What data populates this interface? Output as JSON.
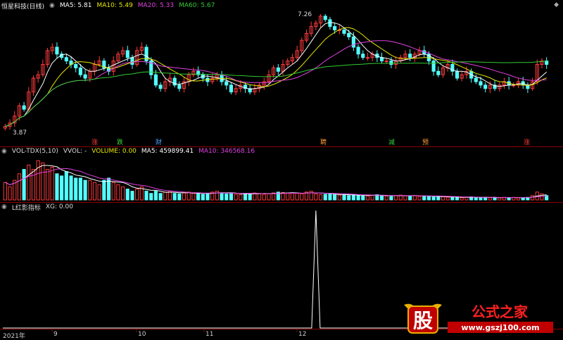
{
  "price_panel": {
    "title": "恒星科技(日线)",
    "ma5": "MA5: 5.81",
    "ma10": "MA10: 5.49",
    "ma20": "MA20: 5.33",
    "ma60": "MA60: 5.67",
    "high_label": "7.26",
    "low_label": "3.87"
  },
  "markers": [
    {
      "text": "涨",
      "color": "#ff3b3b"
    },
    {
      "text": "跌",
      "color": "#3ad13a"
    },
    {
      "text": "财",
      "color": "#4aa0ff"
    },
    {
      "text": "聘",
      "color": "#ff9a3a"
    },
    {
      "text": "减",
      "color": "#3ad13a"
    },
    {
      "text": "预",
      "color": "#ff9a3a"
    },
    {
      "text": "涨",
      "color": "#ff3b3b"
    }
  ],
  "vol_panel": {
    "name": "VOL-TDX(5,10)",
    "vvol": "VVOL: -",
    "volume": "VOLUME: 0.00",
    "ma5": "MA5: 459899.41",
    "ma10": "MA10: 346568.16"
  },
  "ind_panel": {
    "name": "L红影指标",
    "xg": "XG: 0.00"
  },
  "calendar": [
    "2021年",
    "9",
    "10",
    "11",
    "12"
  ],
  "watermark": {
    "logo": "股",
    "text": "公式之家",
    "url": "www.gszj100.com"
  },
  "colors": {
    "up": "#ff3b3b",
    "down": "#54ffff",
    "ma5": "#ffffff",
    "ma10": "#e6e600",
    "ma20": "#e040e0",
    "ma60": "#33cc33",
    "grid": "#7a0000",
    "xg": "#ffffff"
  },
  "chart_data": {
    "type": "candlestick",
    "price_closes": [
      4.0,
      4.1,
      4.3,
      4.6,
      4.5,
      5.0,
      5.4,
      5.5,
      5.8,
      6.2,
      6.3,
      6.1,
      6.0,
      5.9,
      5.8,
      5.7,
      5.5,
      5.4,
      5.6,
      5.8,
      5.9,
      5.7,
      5.6,
      5.9,
      6.1,
      6.2,
      6.0,
      5.8,
      6.2,
      6.3,
      5.9,
      5.5,
      5.2,
      5.1,
      5.3,
      5.4,
      5.2,
      5.1,
      5.3,
      5.5,
      5.6,
      5.5,
      5.4,
      5.3,
      5.4,
      5.5,
      5.3,
      5.2,
      5.0,
      5.1,
      5.2,
      5.1,
      5.0,
      5.1,
      5.2,
      5.3,
      5.5,
      5.7,
      5.6,
      5.8,
      5.9,
      6.0,
      6.2,
      6.5,
      6.7,
      6.9,
      7.0,
      7.2,
      7.1,
      6.9,
      6.8,
      6.8,
      6.7,
      6.6,
      6.3,
      6.1,
      6.0,
      6.0,
      6.1,
      6.0,
      5.9,
      5.9,
      5.8,
      5.9,
      6.0,
      6.1,
      6.0,
      6.1,
      6.2,
      6.1,
      5.9,
      5.6,
      5.5,
      5.7,
      5.8,
      5.6,
      5.4,
      5.5,
      5.6,
      5.4,
      5.3,
      5.2,
      5.1,
      5.2,
      5.1,
      5.2,
      5.3,
      5.2,
      5.2,
      5.3,
      5.2,
      5.1,
      5.3,
      5.8,
      5.9,
      5.8
    ],
    "volume_bars": [
      0.4,
      0.3,
      0.45,
      0.6,
      0.7,
      0.8,
      0.7,
      0.9,
      0.85,
      0.7,
      0.75,
      0.6,
      0.55,
      0.65,
      0.55,
      0.5,
      0.5,
      0.45,
      0.45,
      0.4,
      0.35,
      0.45,
      0.5,
      0.4,
      0.35,
      0.3,
      0.25,
      0.2,
      0.25,
      0.3,
      0.2,
      0.15,
      0.2,
      0.15,
      0.18,
      0.2,
      0.15,
      0.14,
      0.16,
      0.18,
      0.15,
      0.14,
      0.13,
      0.15,
      0.18,
      0.2,
      0.16,
      0.14,
      0.15,
      0.13,
      0.12,
      0.15,
      0.14,
      0.16,
      0.15,
      0.13,
      0.14,
      0.16,
      0.18,
      0.17,
      0.15,
      0.16,
      0.15,
      0.14,
      0.18,
      0.2,
      0.14,
      0.12,
      0.13,
      0.15,
      0.12,
      0.11,
      0.12,
      0.1,
      0.12,
      0.11,
      0.1,
      0.09,
      0.11,
      0.12,
      0.1,
      0.09,
      0.08,
      0.1,
      0.11,
      0.1,
      0.09,
      0.1,
      0.08,
      0.09,
      0.08,
      0.07,
      0.08,
      0.07,
      0.06,
      0.07,
      0.06,
      0.05,
      0.06,
      0.07,
      0.06,
      0.05,
      0.06,
      0.05,
      0.06,
      0.05,
      0.06,
      0.05,
      0.06,
      0.05,
      0.05,
      0.06,
      0.1,
      0.18,
      0.14,
      0.1
    ],
    "xg_spike_index": 66
  }
}
